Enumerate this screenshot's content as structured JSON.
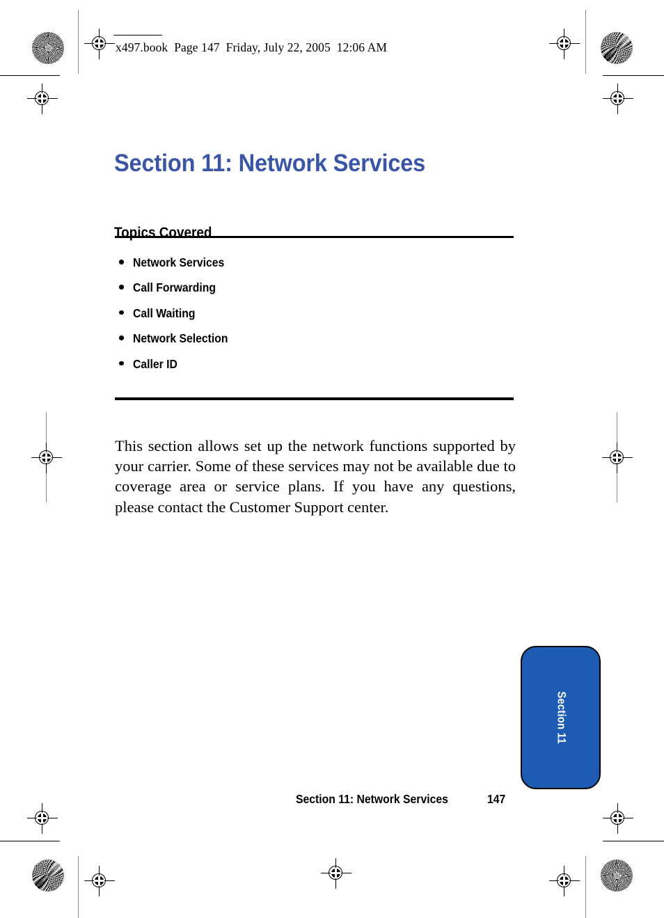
{
  "print_header": {
    "text": "x497.book  Page 147  Friday, July 22, 2005  12:06 AM"
  },
  "section": {
    "title": "Section 11: Network Services",
    "title_color": "#3b55a5"
  },
  "topics": {
    "heading": "Topics Covered",
    "items": [
      {
        "label": "Network Services"
      },
      {
        "label": "Call Forwarding"
      },
      {
        "label": "Call Waiting"
      },
      {
        "label": "Network Selection"
      },
      {
        "label": "Caller ID"
      }
    ]
  },
  "body": {
    "paragraph": "This section allows set up the network functions supported by your carrier. Some of these services may not be available due to coverage area or service plans. If you have any questions, please contact the Customer Support center."
  },
  "side_tab": {
    "label": "Section 11",
    "background_color": "#1e5cb3",
    "text_color": "#ffffff"
  },
  "footer": {
    "title": "Section 11: Network Services",
    "page_number": "147"
  }
}
